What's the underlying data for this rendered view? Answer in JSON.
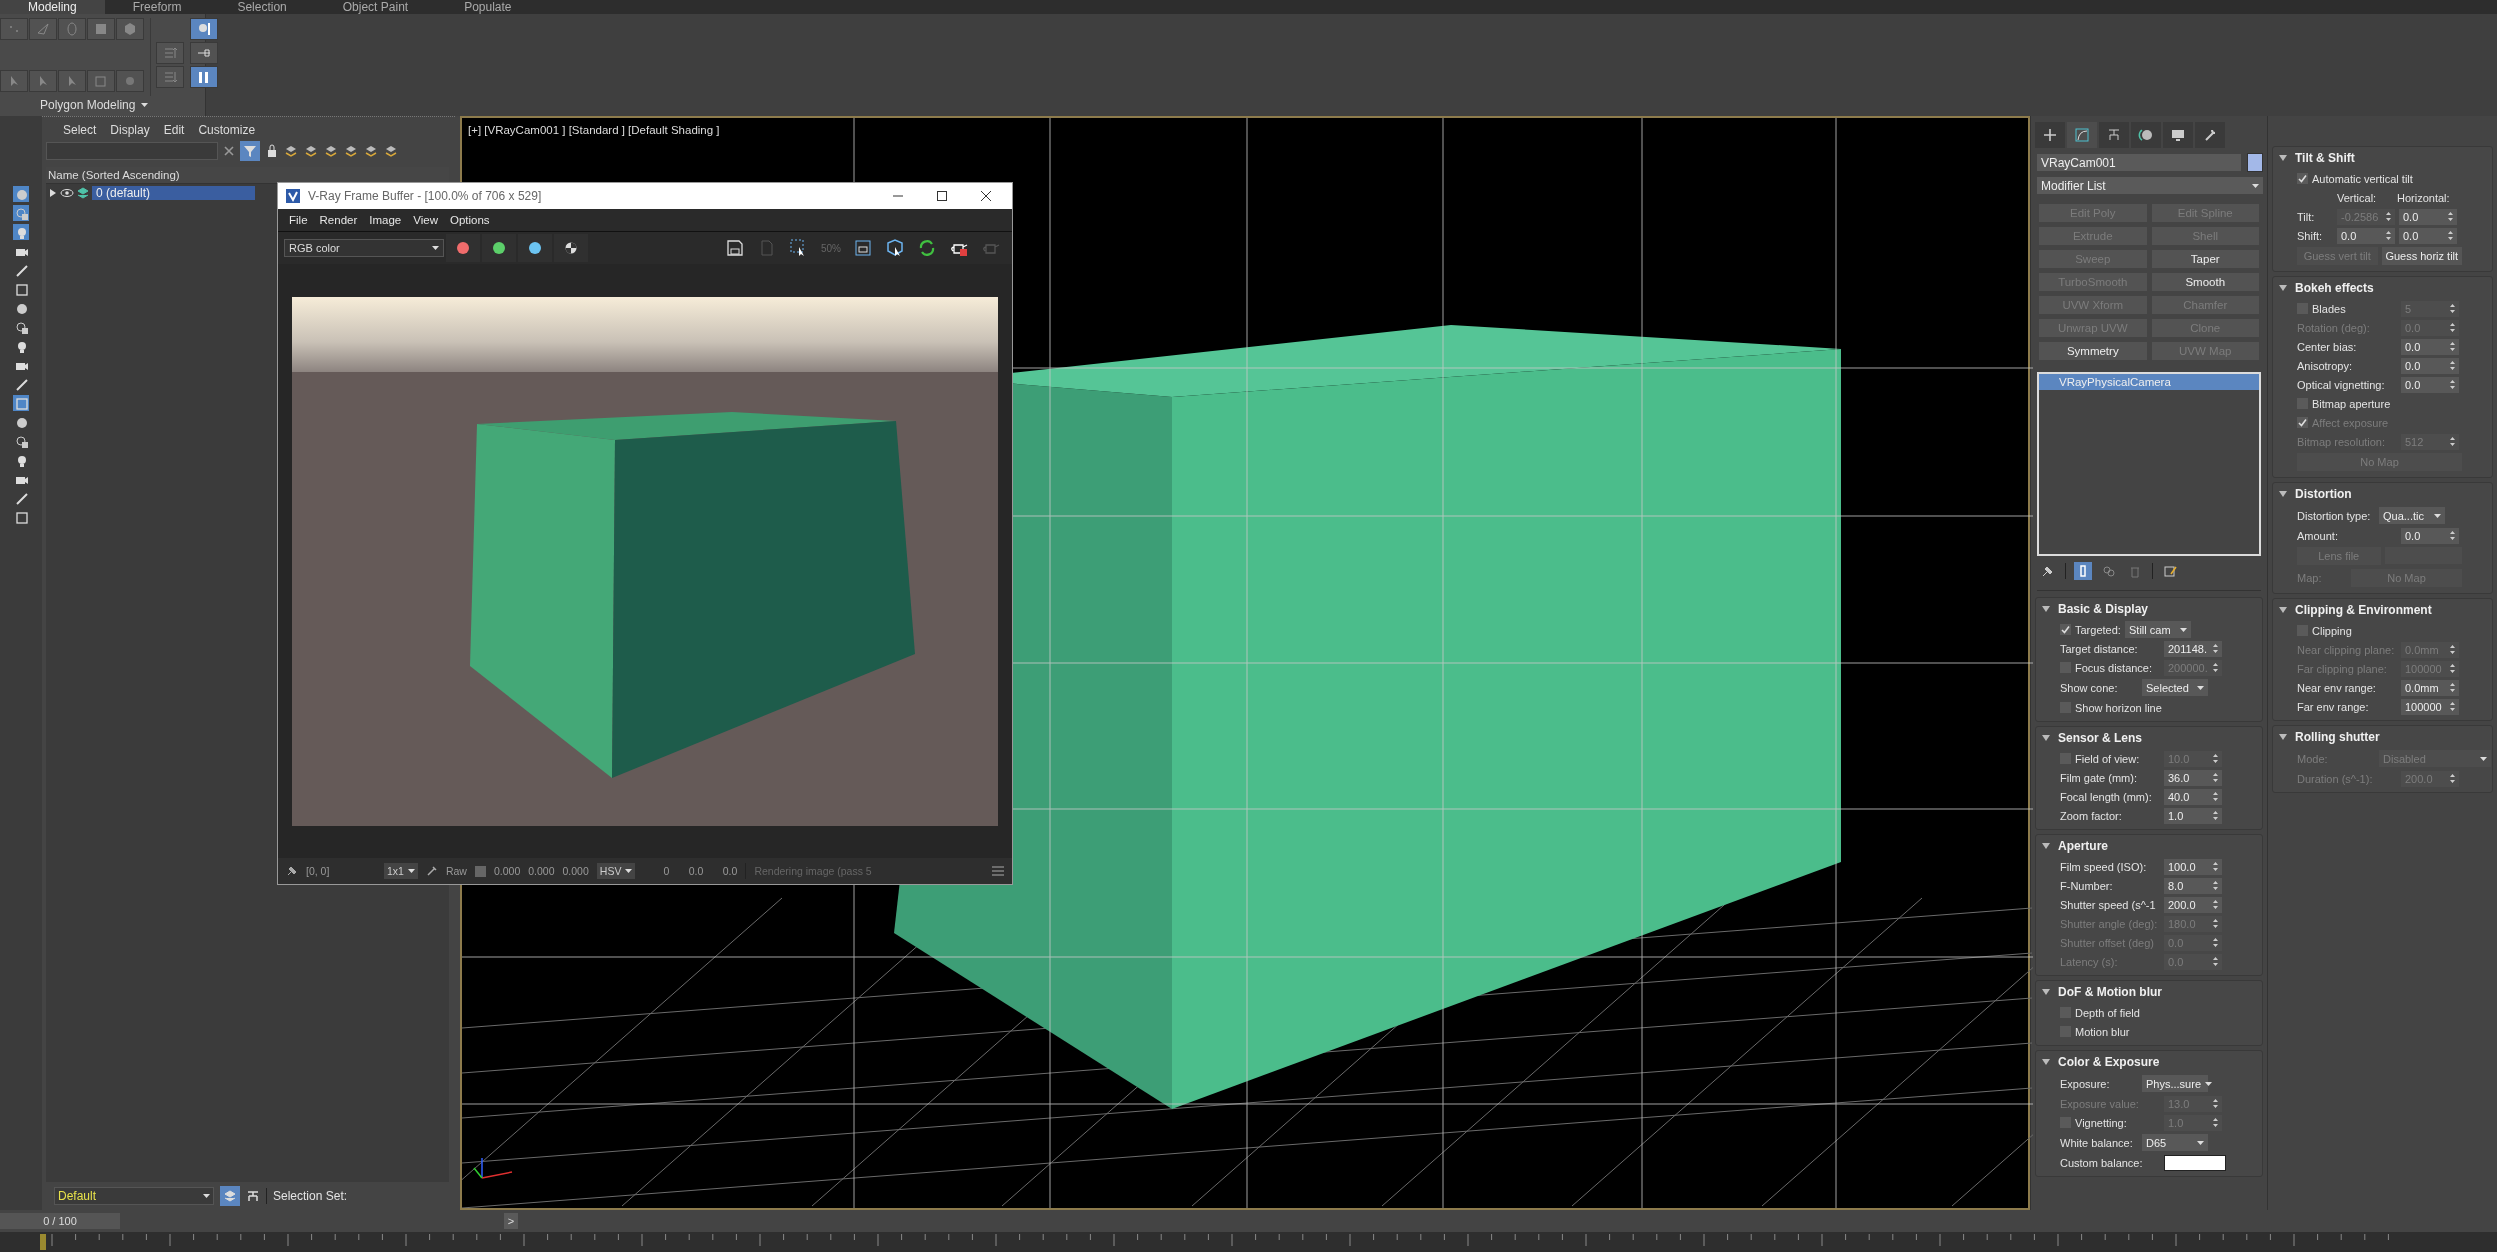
{
  "ribbon": {
    "tabs": [
      {
        "label": "Modeling",
        "selected": true
      },
      {
        "label": "Freeform",
        "selected": false
      },
      {
        "label": "Selection",
        "selected": false
      },
      {
        "label": "Object Paint",
        "selected": false
      },
      {
        "label": "Populate",
        "selected": false
      }
    ],
    "toggles": [
      {
        "on": true
      },
      {
        "on": false
      },
      {
        "on": true
      }
    ],
    "panel_label": "Polygon Modeling"
  },
  "tool_column": [
    {
      "on": true
    },
    {
      "on": true
    },
    {
      "on": true
    },
    {
      "on": false
    },
    {
      "on": false
    },
    {
      "on": false
    },
    {
      "on": false
    },
    {
      "on": false
    },
    {
      "on": false
    },
    {
      "on": false
    },
    {
      "on": false
    },
    {
      "on": true
    },
    {
      "on": false
    },
    {
      "on": false
    },
    {
      "on": false
    },
    {
      "on": false
    },
    {
      "on": false
    },
    {
      "on": false
    }
  ],
  "scene_explorer": {
    "menu": [
      "Select",
      "Display",
      "Edit",
      "Customize"
    ],
    "filter": {
      "on": true
    },
    "column_header": "Name (Sorted Ascending)",
    "rows": [
      {
        "label": "0 (default)",
        "selected": true,
        "expanded": false
      }
    ],
    "layer": "Default",
    "layer_button": {
      "on": true
    },
    "selection_set_label": "Selection Set:"
  },
  "time_slider": {
    "value": "0 / 100",
    "level": 0,
    "next": ">"
  },
  "viewport": {
    "label": "[+] [VRayCam001 ] [Standard ] [Default Shading ]"
  },
  "frame_buffer": {
    "title": "V-Ray Frame Buffer - [100.0% of 706 x 529]",
    "menu": [
      "File",
      "Render",
      "Image",
      "View",
      "Options"
    ],
    "channel": "RGB color",
    "channel_buttons": [
      {
        "color": "#f06c6c"
      },
      {
        "color": "#5ccf6a"
      },
      {
        "color": "#6cc4f2"
      }
    ],
    "zoom_button": "50%",
    "status": {
      "coords": "[0, 0]",
      "zoom": "1x1",
      "raw": "Raw",
      "raw_checked": false,
      "values": [
        "0.000",
        "0.000",
        "0.000"
      ],
      "mode": "HSV",
      "hsv": [
        "0",
        "0.0",
        "0.0"
      ],
      "message": "Rendering image (pass 5"
    }
  },
  "command_panel": {
    "tabs": [
      {
        "selected": false
      },
      {
        "selected": true
      },
      {
        "selected": false
      },
      {
        "selected": false
      },
      {
        "selected": false
      },
      {
        "selected": false
      }
    ],
    "object_name": "VRayCam001",
    "modifier_list": "Modifier List",
    "modifiers": [
      {
        "label": "Edit Poly",
        "disabled": true
      },
      {
        "label": "Edit Spline",
        "disabled": true
      },
      {
        "label": "Extrude",
        "disabled": true
      },
      {
        "label": "Shell",
        "disabled": true
      },
      {
        "label": "Sweep",
        "disabled": true
      },
      {
        "label": "Taper",
        "disabled": false
      },
      {
        "label": "TurboSmooth",
        "disabled": true
      },
      {
        "label": "Smooth",
        "disabled": false
      },
      {
        "label": "UVW Xform",
        "disabled": true
      },
      {
        "label": "Chamfer",
        "disabled": true
      },
      {
        "label": "Unwrap UVW",
        "disabled": true
      },
      {
        "label": "Clone",
        "disabled": true
      },
      {
        "label": "Symmetry",
        "disabled": false
      },
      {
        "label": "UVW Map",
        "disabled": true
      }
    ],
    "stack": [
      {
        "label": "VRayPhysicalCamera",
        "selected": true
      }
    ],
    "stack_tools": [
      {
        "on": false
      },
      {
        "on": true
      },
      {
        "on": false
      },
      {
        "on": false
      },
      {
        "on": false
      }
    ],
    "rollouts": [
      {
        "title": "Basic & Display",
        "expanded": true,
        "rows": [
          {
            "kind": "check_dropdown",
            "label": "Targeted:",
            "checked": true,
            "value": "Still cam"
          },
          {
            "kind": "spinner",
            "label": "Target distance:",
            "value": "201148.",
            "disabled": false
          },
          {
            "kind": "check_spinner",
            "label": "Focus distance:",
            "checked": false,
            "value": "200000.",
            "disabled": true
          },
          {
            "kind": "dropdown",
            "label": "Show cone:",
            "value": "Selected",
            "disabled": false
          },
          {
            "kind": "check",
            "label": "Show horizon line",
            "checked": false,
            "disabled": false
          }
        ]
      },
      {
        "title": "Sensor & Lens",
        "expanded": true,
        "rows": [
          {
            "kind": "check_spinner",
            "label": "Field of view:",
            "checked": false,
            "value": "10.0",
            "disabled": true
          },
          {
            "kind": "spinner",
            "label": "Film gate (mm):",
            "value": "36.0",
            "disabled": false
          },
          {
            "kind": "spinner",
            "label": "Focal length (mm):",
            "value": "40.0",
            "disabled": false
          },
          {
            "kind": "spinner",
            "label": "Zoom factor:",
            "value": "1.0",
            "disabled": false
          }
        ]
      },
      {
        "title": "Aperture",
        "expanded": true,
        "rows": [
          {
            "kind": "spinner",
            "label": "Film speed (ISO):",
            "value": "100.0",
            "disabled": false
          },
          {
            "kind": "spinner",
            "label": "F-Number:",
            "value": "8.0",
            "disabled": false
          },
          {
            "kind": "spinner",
            "label": "Shutter speed (s^-1",
            "value": "200.0",
            "disabled": false
          },
          {
            "kind": "spinner",
            "label": "Shutter angle (deg):",
            "value": "180.0",
            "disabled": true
          },
          {
            "kind": "spinner",
            "label": "Shutter offset (deg)",
            "value": "0.0",
            "disabled": true
          },
          {
            "kind": "spinner",
            "label": "Latency (s):",
            "value": "0.0",
            "disabled": true
          }
        ]
      },
      {
        "title": "DoF & Motion blur",
        "expanded": true,
        "rows": [
          {
            "kind": "check",
            "label": "Depth of field",
            "checked": false,
            "disabled": false
          },
          {
            "kind": "check",
            "label": "Motion blur",
            "checked": false,
            "disabled": false
          }
        ]
      },
      {
        "title": "Color & Exposure",
        "expanded": true,
        "rows": [
          {
            "kind": "dropdown",
            "label": "Exposure:",
            "value": "Phys...sure",
            "disabled": false
          },
          {
            "kind": "spinner",
            "label": "Exposure value:",
            "value": "13.0",
            "disabled": true
          },
          {
            "kind": "check_spinner",
            "label": "Vignetting:",
            "checked": false,
            "value": "1.0",
            "disabled": true
          },
          {
            "kind": "dropdown",
            "label": "White balance:",
            "value": "D65",
            "disabled": false
          },
          {
            "kind": "color_swatch",
            "label": "Custom balance:",
            "color": "#ffffff"
          }
        ]
      }
    ]
  },
  "rollouts_right": [
    {
      "title": "Tilt & Shift",
      "expanded": true,
      "rows": [
        {
          "kind": "check",
          "label": "Automatic vertical tilt",
          "checked": true,
          "disabled": false
        },
        {
          "kind": "columns",
          "labels": [
            "Vertical:",
            "Horizontal:"
          ]
        },
        {
          "kind": "spinner_pair",
          "label": "Tilt:",
          "values": [
            {
              "value": "-0.2586",
              "disabled": true
            },
            {
              "value": "0.0",
              "disabled": false
            }
          ]
        },
        {
          "kind": "spinner_pair",
          "label": "Shift:",
          "values": [
            {
              "value": "0.0",
              "disabled": false
            },
            {
              "value": "0.0",
              "disabled": false
            }
          ]
        },
        {
          "kind": "buttons",
          "buttons": [
            {
              "label": "Guess vert tilt",
              "disabled": true
            },
            {
              "label": "Guess horiz tilt",
              "disabled": false
            }
          ]
        }
      ]
    },
    {
      "title": "Bokeh effects",
      "expanded": true,
      "rows": [
        {
          "kind": "check_spinner",
          "label": "Blades",
          "checked": false,
          "value": "5",
          "disabled": true
        },
        {
          "kind": "spinner",
          "label": "Rotation (deg):",
          "value": "0.0",
          "disabled": true
        },
        {
          "kind": "spinner",
          "label": "Center bias:",
          "value": "0.0",
          "disabled": false
        },
        {
          "kind": "spinner",
          "label": "Anisotropy:",
          "value": "0.0",
          "disabled": false
        },
        {
          "kind": "spinner",
          "label": "Optical vignetting:",
          "value": "0.0",
          "disabled": false
        },
        {
          "kind": "check",
          "label": "Bitmap aperture",
          "checked": false,
          "disabled": false
        },
        {
          "kind": "check",
          "label": "Affect exposure",
          "checked": true,
          "disabled": true
        },
        {
          "kind": "spinner",
          "label": "Bitmap resolution:",
          "value": "512",
          "disabled": true
        },
        {
          "kind": "buttons",
          "buttons": [
            {
              "label": "No Map",
              "disabled": true
            }
          ]
        }
      ]
    },
    {
      "title": "Distortion",
      "expanded": true,
      "rows": [
        {
          "kind": "dropdown",
          "label": "Distortion type:",
          "value": "Qua...tic",
          "disabled": false
        },
        {
          "kind": "spinner",
          "label": "Amount:",
          "value": "0.0",
          "disabled": false
        },
        {
          "kind": "button_field",
          "label": "Lens file",
          "disabled": true
        },
        {
          "kind": "map",
          "label": "Map:",
          "button": "No Map",
          "disabled": true
        }
      ]
    },
    {
      "title": "Clipping & Environment",
      "expanded": true,
      "rows": [
        {
          "kind": "check",
          "label": "Clipping",
          "checked": false,
          "disabled": false
        },
        {
          "kind": "spinner",
          "label": "Near clipping plane:",
          "value": "0.0mm",
          "disabled": true
        },
        {
          "kind": "spinner",
          "label": "Far clipping plane:",
          "value": "100000",
          "disabled": true
        },
        {
          "kind": "spinner",
          "label": "Near env range:",
          "value": "0.0mm",
          "disabled": false
        },
        {
          "kind": "spinner",
          "label": "Far env range:",
          "value": "100000",
          "disabled": false
        }
      ]
    },
    {
      "title": "Rolling shutter",
      "expanded": true,
      "rows": [
        {
          "kind": "dropdown",
          "label": "Mode:",
          "value": "Disabled",
          "disabled": true
        },
        {
          "kind": "spinner",
          "label": "Duration (s^-1):",
          "value": "200.0",
          "disabled": true
        }
      ]
    }
  ]
}
